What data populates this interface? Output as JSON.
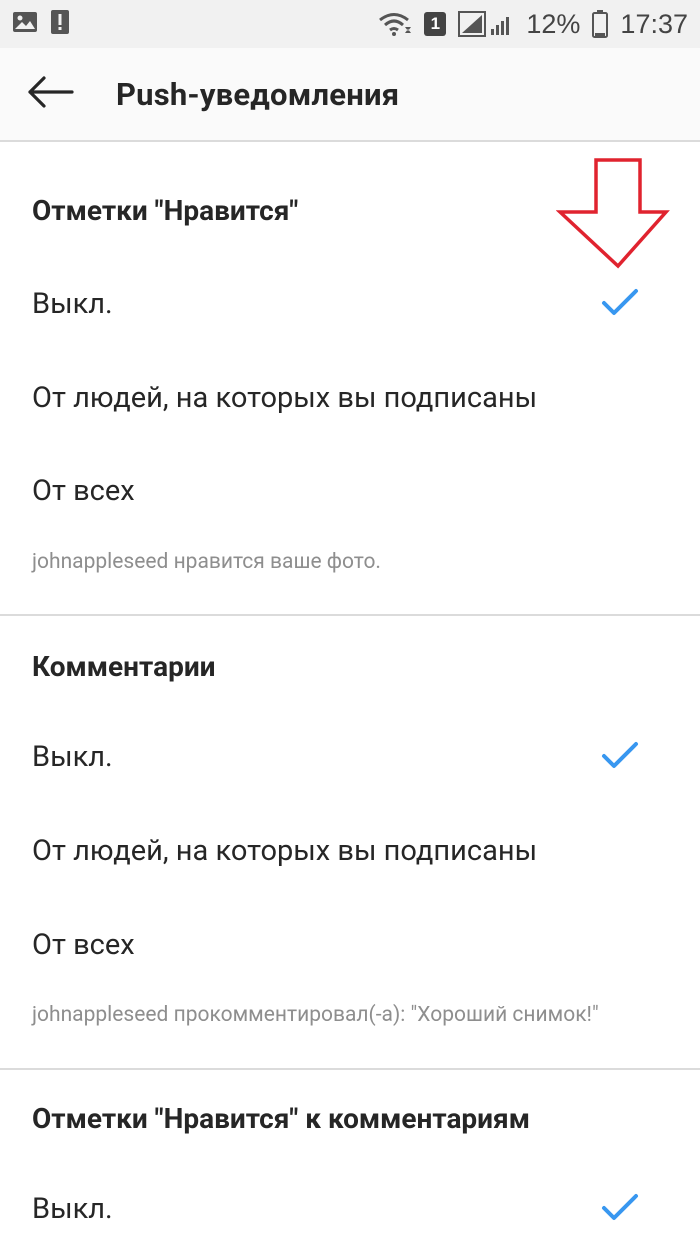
{
  "status_bar": {
    "notification_count": "1",
    "battery_percent": "12%",
    "time": "17:37"
  },
  "header": {
    "title": "Push-уведомления"
  },
  "sections": [
    {
      "title": "Отметки \"Нравится\"",
      "options": [
        "Выкл.",
        "От людей, на которых вы подписаны",
        "От всех"
      ],
      "selected_index": 0,
      "example": "johnappleseed нравится ваше фото."
    },
    {
      "title": "Комментарии",
      "options": [
        "Выкл.",
        "От людей, на которых вы подписаны",
        "От всех"
      ],
      "selected_index": 0,
      "example": "johnappleseed прокомментировал(-а): \"Хороший снимок!\""
    },
    {
      "title": "Отметки \"Нравится\" к комментариям",
      "options": [
        "Выкл."
      ],
      "selected_index": 0
    }
  ],
  "colors": {
    "check": "#3897f0",
    "annotation_arrow": "#e0232f",
    "divider": "#dbdbdb"
  }
}
